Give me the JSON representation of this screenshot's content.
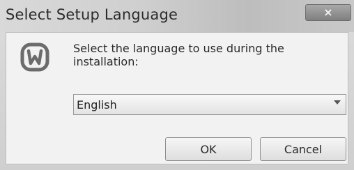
{
  "window": {
    "title": "Select Setup Language",
    "close_glyph": "×"
  },
  "dialog": {
    "prompt": "Select the language to use during the installation:",
    "logo_icon": "wampserver-logo-icon",
    "language_select": {
      "selected": "English"
    },
    "buttons": {
      "ok_label": "OK",
      "cancel_label": "Cancel"
    }
  }
}
